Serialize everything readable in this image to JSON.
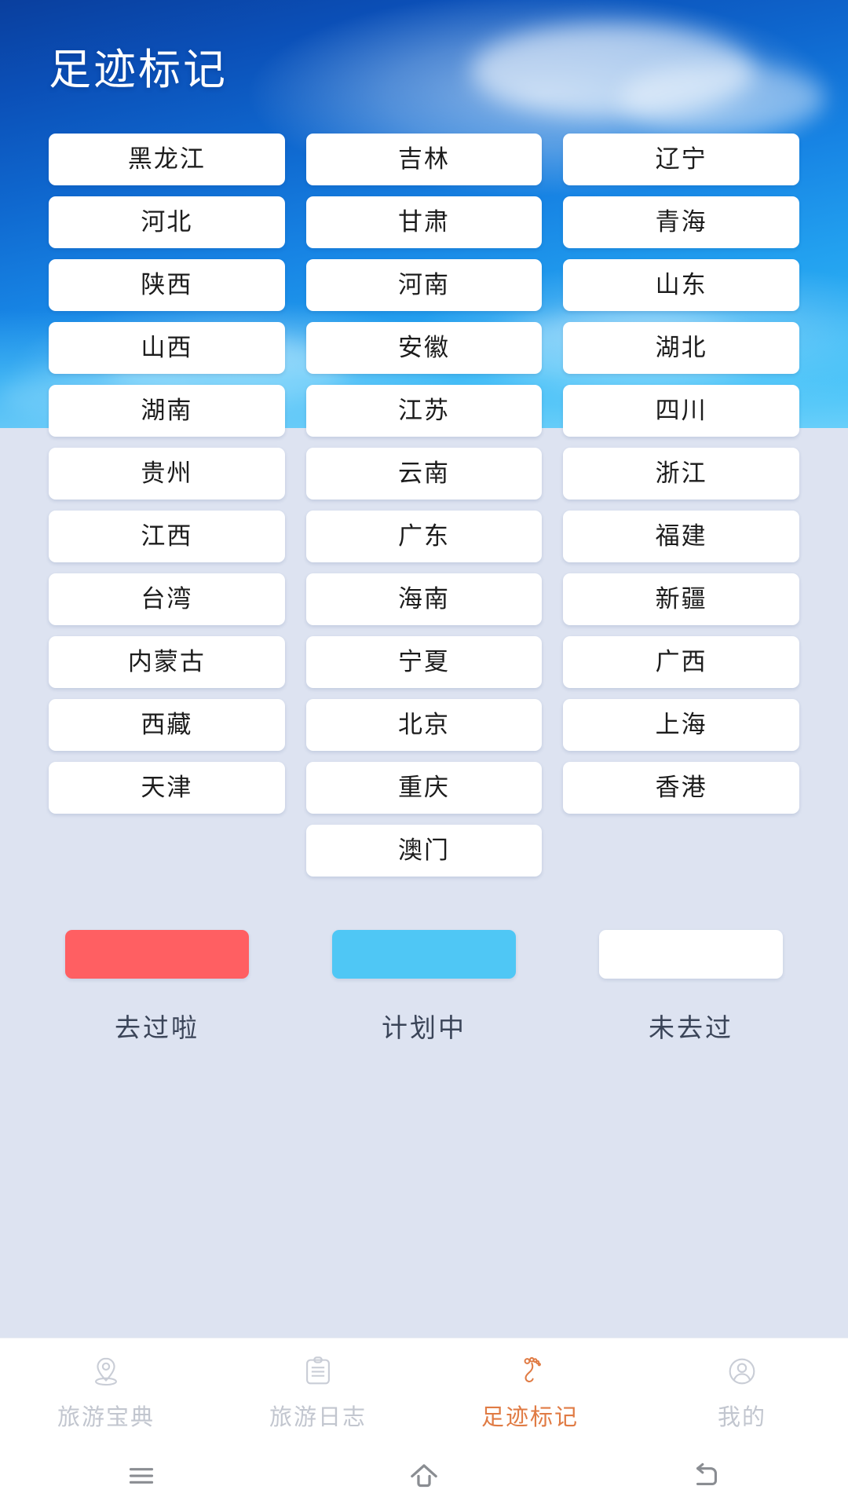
{
  "header": {
    "title": "足迹标记"
  },
  "provinces": [
    {
      "name": "黑龙江",
      "status": "none"
    },
    {
      "name": "吉林",
      "status": "none"
    },
    {
      "name": "辽宁",
      "status": "none"
    },
    {
      "name": "河北",
      "status": "none"
    },
    {
      "name": "甘肃",
      "status": "none"
    },
    {
      "name": "青海",
      "status": "none"
    },
    {
      "name": "陕西",
      "status": "none"
    },
    {
      "name": "河南",
      "status": "none"
    },
    {
      "name": "山东",
      "status": "none"
    },
    {
      "name": "山西",
      "status": "none"
    },
    {
      "name": "安徽",
      "status": "none"
    },
    {
      "name": "湖北",
      "status": "none"
    },
    {
      "name": "湖南",
      "status": "none"
    },
    {
      "name": "江苏",
      "status": "none"
    },
    {
      "name": "四川",
      "status": "none"
    },
    {
      "name": "贵州",
      "status": "none"
    },
    {
      "name": "云南",
      "status": "none"
    },
    {
      "name": "浙江",
      "status": "none"
    },
    {
      "name": "江西",
      "status": "none"
    },
    {
      "name": "广东",
      "status": "none"
    },
    {
      "name": "福建",
      "status": "none"
    },
    {
      "name": "台湾",
      "status": "none"
    },
    {
      "name": "海南",
      "status": "none"
    },
    {
      "name": "新疆",
      "status": "none"
    },
    {
      "name": "内蒙古",
      "status": "none"
    },
    {
      "name": "宁夏",
      "status": "none"
    },
    {
      "name": "广西",
      "status": "none"
    },
    {
      "name": "西藏",
      "status": "none"
    },
    {
      "name": "北京",
      "status": "none"
    },
    {
      "name": "上海",
      "status": "none"
    },
    {
      "name": "天津",
      "status": "none"
    },
    {
      "name": "重庆",
      "status": "none"
    },
    {
      "name": "香港",
      "status": "none"
    },
    {
      "name": "",
      "status": "empty"
    },
    {
      "name": "澳门",
      "status": "none"
    },
    {
      "name": "",
      "status": "empty"
    }
  ],
  "legend": [
    {
      "label": "去过啦",
      "color": "#FF5F62"
    },
    {
      "label": "计划中",
      "color": "#4FC7F5"
    },
    {
      "label": "未去过",
      "color": "#FFFFFF"
    }
  ],
  "tabbar": {
    "active_color": "#E07B44",
    "inactive_color": "#C2C6CF",
    "items": [
      {
        "label": "旅游宝典",
        "icon": "location-pin-icon",
        "active": false
      },
      {
        "label": "旅游日志",
        "icon": "clipboard-icon",
        "active": false
      },
      {
        "label": "足迹标记",
        "icon": "footprint-icon",
        "active": true
      },
      {
        "label": "我的",
        "icon": "user-circle-icon",
        "active": false
      }
    ]
  },
  "system_nav": {
    "items": [
      {
        "name": "menu-icon"
      },
      {
        "name": "home-icon"
      },
      {
        "name": "back-icon"
      }
    ]
  }
}
